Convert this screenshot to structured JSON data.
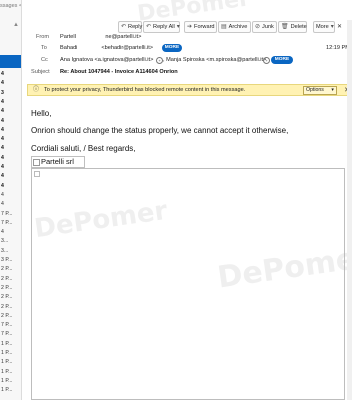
{
  "left": {
    "search_placeholder": "ssages <Ctrl+Shift+K>",
    "items": [
      "4",
      "4",
      "3",
      "4",
      "4",
      "4",
      "4",
      "4",
      "4",
      "4",
      "4",
      "4",
      "4",
      "4",
      "4",
      "7 P...",
      "7 P...",
      "4",
      "3...",
      "3...",
      "3 P...",
      "2 P...",
      "2 P...",
      "2 P...",
      "2 P...",
      "2 P...",
      "2 P...",
      "7 P...",
      "7 P...",
      "1 P...",
      "1 P...",
      "1 P...",
      "1 P...",
      "1 P...",
      "1 P..."
    ]
  },
  "toolbar": {
    "reply": "Reply",
    "reply_all": "Reply All",
    "forward": "Forward",
    "archive": "Archive",
    "junk": "Junk",
    "delete": "Delete",
    "more": "More"
  },
  "header": {
    "from_label": "From",
    "from_value": "Partell      ne@partelli.it>",
    "to_label": "To",
    "to_value": "Bahadi     <behadir@partelli.it>",
    "more": "MORE",
    "time": "12:19 PM",
    "cc_label": "Cc",
    "cc_value": "Ana Ignatova <a.ignatova@partelli.it>",
    "cc_value2": ", Manja Spiroska <m.spiroska@partelli.it>",
    "subject_label": "Subject",
    "subject_value": "Re: About 1047944 - Invoice A114604 Onrion"
  },
  "notice": {
    "text": "To protect your privacy, Thunderbird has blocked remote content in this message.",
    "options": "Options"
  },
  "body": {
    "greeting": "Hello,",
    "line1": "Onrion should change the status properly, we cannot accept it otherwise,",
    "closing": "Cordiali saluti, / Best regards,",
    "signature": "Partelli srl"
  },
  "watermark": "DePomer"
}
